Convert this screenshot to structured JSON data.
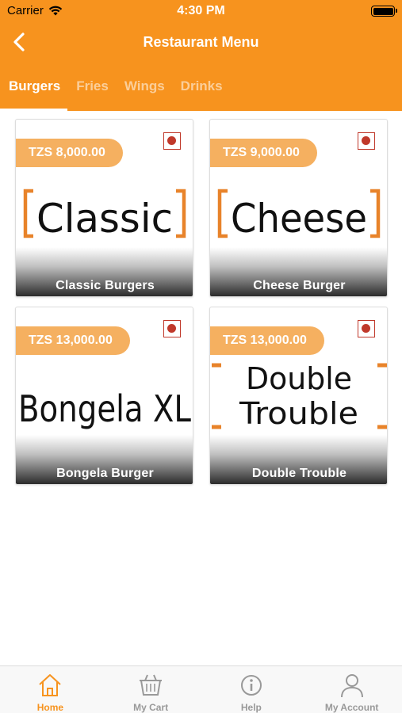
{
  "status_bar": {
    "carrier": "Carrier",
    "time": "4:30 PM"
  },
  "navbar": {
    "title": "Restaurant Menu"
  },
  "tabs": [
    {
      "label": "Burgers",
      "active": true
    },
    {
      "label": "Fries",
      "active": false
    },
    {
      "label": "Wings",
      "active": false
    },
    {
      "label": "Drinks",
      "active": false
    }
  ],
  "menu_items": [
    {
      "price": "TZS 8,000.00",
      "logo_text": "Classic",
      "name": "Classic Burgers"
    },
    {
      "price": "TZS 9,000.00",
      "logo_text": "Cheese",
      "name": "Cheese Burger"
    },
    {
      "price": "TZS 13,000.00",
      "logo_text": "Bongela XL",
      "name": "Bongela Burger"
    },
    {
      "price": "TZS 13,000.00",
      "logo_text": "Double Trouble",
      "name": "Double Trouble"
    }
  ],
  "bottom_nav": [
    {
      "label": "Home",
      "icon": "home-icon",
      "active": true
    },
    {
      "label": "My Cart",
      "icon": "cart-icon",
      "active": false
    },
    {
      "label": "Help",
      "icon": "help-icon",
      "active": false
    },
    {
      "label": "My Account",
      "icon": "account-icon",
      "active": false
    }
  ],
  "colors": {
    "accent": "#f7931e",
    "price_tag": "#f5b060",
    "badge": "#c0392b",
    "inactive": "#999999"
  }
}
